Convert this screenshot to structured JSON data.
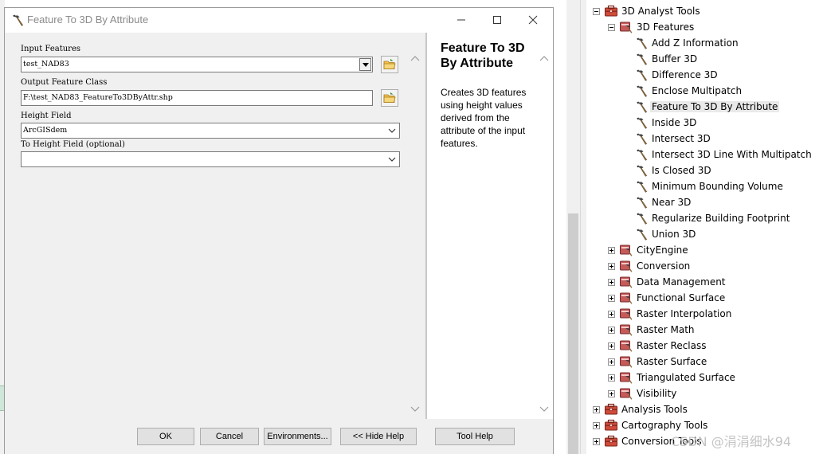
{
  "dialog": {
    "title": "Feature To 3D By Attribute",
    "fields": {
      "input_features": {
        "label": "Input Features",
        "value": "test_NAD83"
      },
      "output_feature_class": {
        "label": "Output Feature Class",
        "value": "F:\\test_NAD83_FeatureTo3DByAttr.shp"
      },
      "height_field": {
        "label": "Height Field",
        "value": "ArcGISdem"
      },
      "to_height_field": {
        "label": "To Height Field (optional)",
        "value": ""
      }
    },
    "help": {
      "title": "Feature To 3D By Attribute",
      "body": "Creates 3D features using height values derived from the attribute of the input features."
    },
    "buttons": {
      "ok": "OK",
      "cancel": "Cancel",
      "environments": "Environments...",
      "hide_help": "<< Hide Help",
      "tool_help": "Tool Help"
    }
  },
  "toolbox": {
    "root": "3D Analyst Tools",
    "open_toolset": "3D Features",
    "tools": [
      "Add Z Information",
      "Buffer 3D",
      "Difference 3D",
      "Enclose Multipatch",
      "Feature To 3D By Attribute",
      "Inside 3D",
      "Intersect 3D",
      "Intersect 3D Line With Multipatch",
      "Is Closed 3D",
      "Minimum Bounding Volume",
      "Near 3D",
      "Regularize Building Footprint",
      "Union 3D"
    ],
    "selected_tool": "Feature To 3D By Attribute",
    "toolsets": [
      "CityEngine",
      "Conversion",
      "Data Management",
      "Functional Surface",
      "Raster Interpolation",
      "Raster Math",
      "Raster Reclass",
      "Raster Surface",
      "Triangulated Surface",
      "Visibility"
    ],
    "other_toolboxes": [
      "Analysis Tools",
      "Cartography Tools",
      "Conversion Tools"
    ]
  },
  "watermark": "CSDN @涓涓细水94"
}
